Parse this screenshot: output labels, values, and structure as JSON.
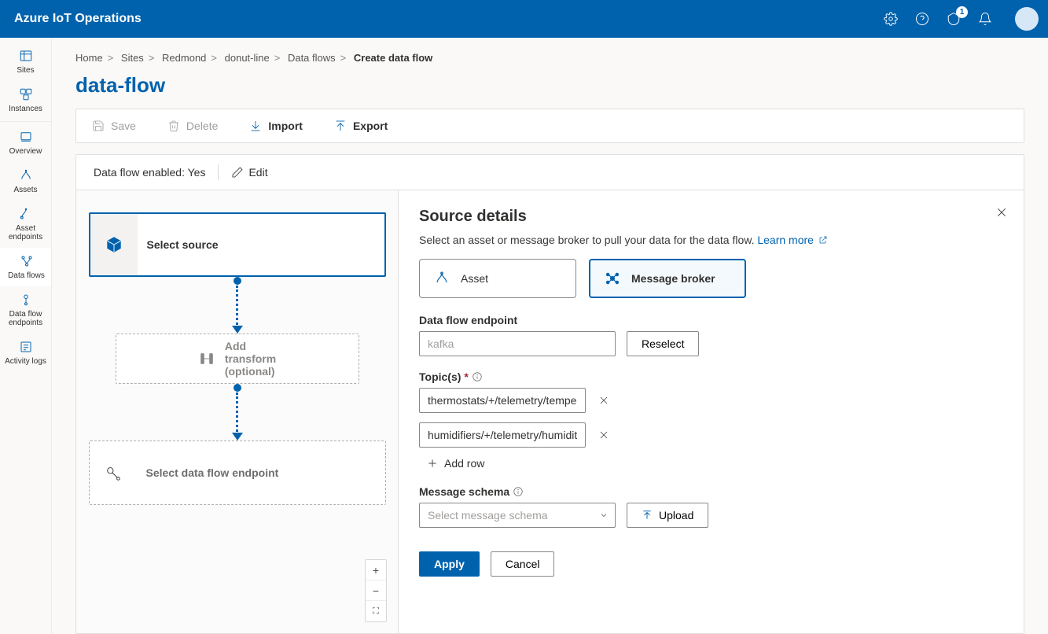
{
  "header": {
    "title": "Azure IoT Operations",
    "notification_count": "1"
  },
  "nav": {
    "items": [
      {
        "label": "Sites"
      },
      {
        "label": "Instances"
      },
      {
        "label": "Overview"
      },
      {
        "label": "Assets"
      },
      {
        "label": "Asset endpoints"
      },
      {
        "label": "Data flows"
      },
      {
        "label": "Data flow endpoints"
      },
      {
        "label": "Activity logs"
      }
    ]
  },
  "breadcrumbs": {
    "items": [
      "Home",
      "Sites",
      "Redmond",
      "donut-line",
      "Data flows"
    ],
    "current": "Create data flow"
  },
  "page": {
    "title": "data-flow"
  },
  "toolbar": {
    "save": "Save",
    "delete": "Delete",
    "import": "Import",
    "export": "Export"
  },
  "status": {
    "label": "Data flow enabled:",
    "value": "Yes",
    "edit": "Edit"
  },
  "canvas": {
    "source": "Select source",
    "transform": "Add transform (optional)",
    "destination": "Select data flow endpoint"
  },
  "panel": {
    "title": "Source details",
    "description": "Select an asset or message broker to pull your data for the data flow.",
    "learn_more": "Learn more",
    "tab_asset": "Asset",
    "tab_broker": "Message broker",
    "endpoint_label": "Data flow endpoint",
    "endpoint_placeholder": "kafka",
    "reselect": "Reselect",
    "topics_label": "Topic(s)",
    "topics": [
      "thermostats/+/telemetry/temperature/#",
      "humidifiers/+/telemetry/humidity/#"
    ],
    "add_row": "Add row",
    "schema_label": "Message schema",
    "schema_placeholder": "Select message schema",
    "upload": "Upload",
    "apply": "Apply",
    "cancel": "Cancel"
  }
}
